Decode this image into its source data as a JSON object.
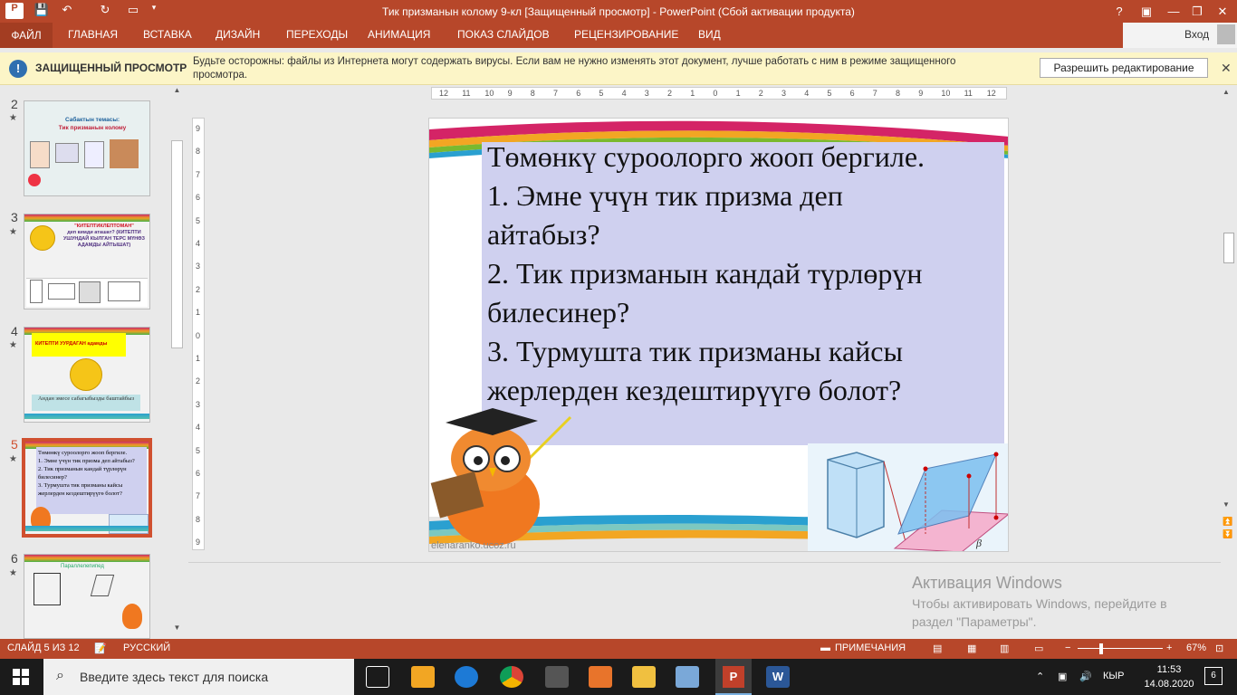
{
  "titlebar": {
    "title": "Тик призманын колому 9-кл [Защищенный просмотр] -  PowerPoint (Сбой активации продукта)",
    "help": "?",
    "minimize": "—",
    "restore": "❐",
    "close": "✕"
  },
  "ribbon": {
    "tabs": [
      "ФАЙЛ",
      "ГЛАВНАЯ",
      "ВСТАВКА",
      "ДИЗАЙН",
      "ПЕРЕХОДЫ",
      "АНИМАЦИЯ",
      "ПОКАЗ СЛАЙДОВ",
      "РЕЦЕНЗИРОВАНИЕ",
      "ВИД"
    ],
    "signin": "Вход"
  },
  "protected": {
    "heading": "ЗАЩИЩЕННЫЙ ПРОСМОТР",
    "message": "Будьте осторожны: файлы из Интернета могут содержать вирусы. Если вам не нужно изменять этот документ, лучше работать с ним в режиме защищенного просмотра.",
    "button": "Разрешить редактирование"
  },
  "thumbnails": [
    {
      "num": "2",
      "lines": [
        "Сабактын темасы:",
        "Тик призманын колому"
      ]
    },
    {
      "num": "3",
      "lines": [
        "\"КИТЕПТИКЛЕПТОМАН\"",
        "деп кимди аташат? (КИТЕПТИ УШУНДАЙ КЫЛГАН ТЕРС МҮНӨЗ АДАМДЫ АЙТЫШАТ)"
      ]
    },
    {
      "num": "4",
      "lines": [
        "КИТЕПТИ УУРДАГАН адамды",
        "Андан эмесе сабагыбызды баштайбыз"
      ]
    },
    {
      "num": "5",
      "lines": [
        "Төмөнкү суроолорго жооп бергиле.",
        "1. Эмне үчүн тик призма деп айтабыз?",
        "2. Тик призманын кандай түрлөрүн билесинер?",
        "3. Турмушта тик призманы кайсы жерлерден кездештирүүгө болот?"
      ]
    },
    {
      "num": "6",
      "lines": [
        "Параллелепипед"
      ]
    }
  ],
  "slide": {
    "lines": [
      "Төмөнкү суроолорго жооп бергиле.",
      "1. Эмне үчүн тик призма деп",
      "айтабыз?",
      "2. Тик призманын кандай түрлөрүн",
      "билесинер?",
      "3. Турмушта тик призманы кайсы",
      "жерлерден кездештирүүгө болот?"
    ],
    "footer": "elenaranko.ucoz.ru",
    "beta": "β"
  },
  "watermark": {
    "title": "Активация Windows",
    "text": "Чтобы активировать Windows, перейдите в раздел \"Параметры\"."
  },
  "status": {
    "slide": "СЛАЙД 5 ИЗ 12",
    "lang": "РУССКИЙ",
    "notes": "ПРИМЕЧАНИЯ",
    "zoom": "67%"
  },
  "taskbar": {
    "search": "Введите здесь текст для поиска",
    "lang": "КЫР",
    "time": "11:53",
    "date": "14.08.2020",
    "notif": "6"
  },
  "ruler_marks": [
    "12",
    "11",
    "10",
    "9",
    "8",
    "7",
    "6",
    "5",
    "4",
    "3",
    "2",
    "1",
    "0",
    "1",
    "2",
    "3",
    "4",
    "5",
    "6",
    "7",
    "8",
    "9",
    "10",
    "11",
    "12"
  ],
  "vruler_marks": [
    "9",
    "8",
    "7",
    "6",
    "5",
    "4",
    "3",
    "2",
    "1",
    "0",
    "1",
    "2",
    "3",
    "4",
    "5",
    "6",
    "7",
    "8",
    "9"
  ],
  "colors": {
    "accent": "#b7472a",
    "slide_box": "#cfd0ef",
    "protect_bar": "#fcf5c7"
  }
}
